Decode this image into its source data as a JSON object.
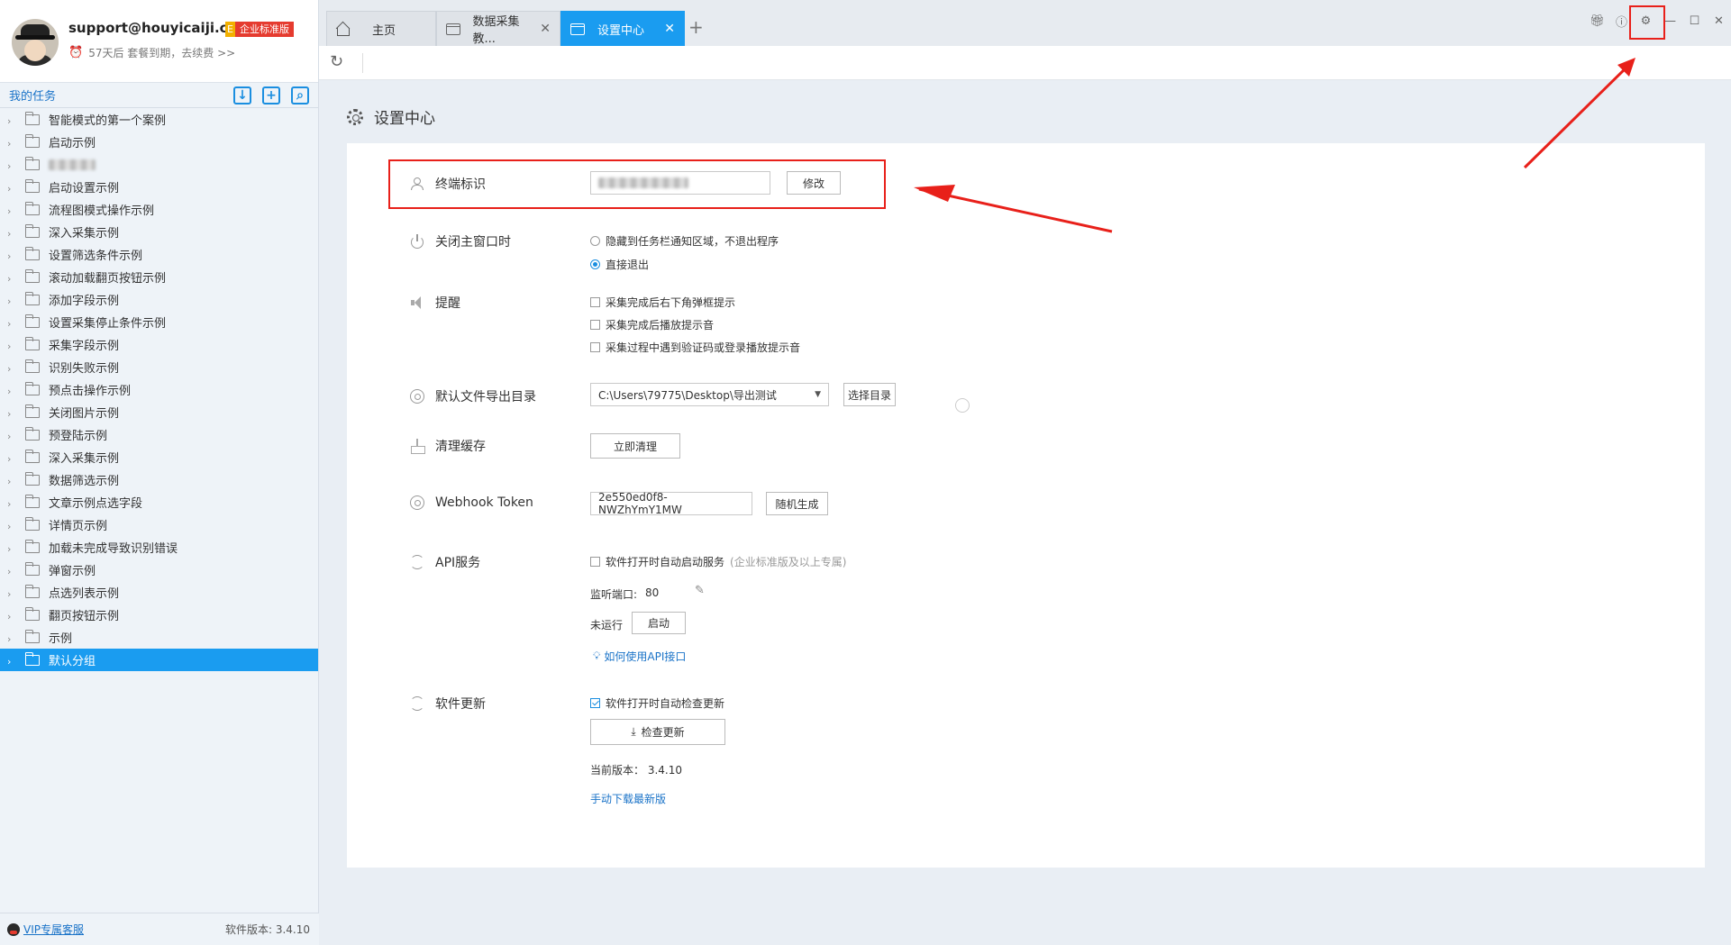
{
  "profile": {
    "email": "support@houyicaiji.c...",
    "badge_e": "E",
    "badge_text": "企业标准版",
    "expire": "57天后 套餐到期，去续费 >>"
  },
  "sidebar": {
    "title": "我的任务",
    "items": [
      "智能模式的第一个案例",
      "启动示例",
      "",
      "启动设置示例",
      "流程图模式操作示例",
      "深入采集示例",
      "设置筛选条件示例",
      "滚动加载翻页按钮示例",
      "添加字段示例",
      "设置采集停止条件示例",
      "采集字段示例",
      "识别失败示例",
      "预点击操作示例",
      "关闭图片示例",
      "预登陆示例",
      "深入采集示例",
      "数据筛选示例",
      "文章示例点选字段",
      "详情页示例",
      "加载未完成导致识别错误",
      "弹窗示例",
      "点选列表示例",
      "翻页按钮示例",
      "示例",
      "默认分组"
    ],
    "vip_link": "VIP专属客服",
    "version": "软件版本: 3.4.10"
  },
  "tabs": [
    {
      "label": "主页"
    },
    {
      "label": "数据采集教..."
    },
    {
      "label": "设置中心"
    }
  ],
  "page_title": "设置中心",
  "settings": {
    "terminal": {
      "label": "终端标识",
      "button": "修改"
    },
    "close_window": {
      "label": "关闭主窗口时",
      "options": [
        "隐藏到任务栏通知区域，不退出程序",
        "直接退出"
      ],
      "selected": 1
    },
    "reminder": {
      "label": "提醒",
      "options": [
        "采集完成后右下角弹框提示",
        "采集完成后播放提示音",
        "采集过程中遇到验证码或登录播放提示音"
      ]
    },
    "export_dir": {
      "label": "默认文件导出目录",
      "value": "C:\\Users\\79775\\Desktop\\导出测试",
      "button": "选择目录"
    },
    "cache": {
      "label": "清理缓存",
      "button": "立即清理"
    },
    "webhook": {
      "label": "Webhook Token",
      "value": "2e550ed0f8-NWZhYmY1MW",
      "button": "随机生成"
    },
    "api": {
      "label": "API服务",
      "auto_start": "软件打开时自动启动服务",
      "auto_start_hint": "(企业标准版及以上专属)",
      "port_label": "监听端口:",
      "port_value": "80",
      "status": "未运行",
      "start_button": "启动",
      "help_link": "如何使用API接口"
    },
    "update": {
      "label": "软件更新",
      "auto_check": "软件打开时自动检查更新",
      "check_button": "检查更新",
      "current_version_label": "当前版本：",
      "current_version": "3.4.10",
      "manual_link": "手动下载最新版"
    }
  },
  "colors": {
    "accent": "#1a9cf0",
    "annotation": "#e8201a"
  }
}
